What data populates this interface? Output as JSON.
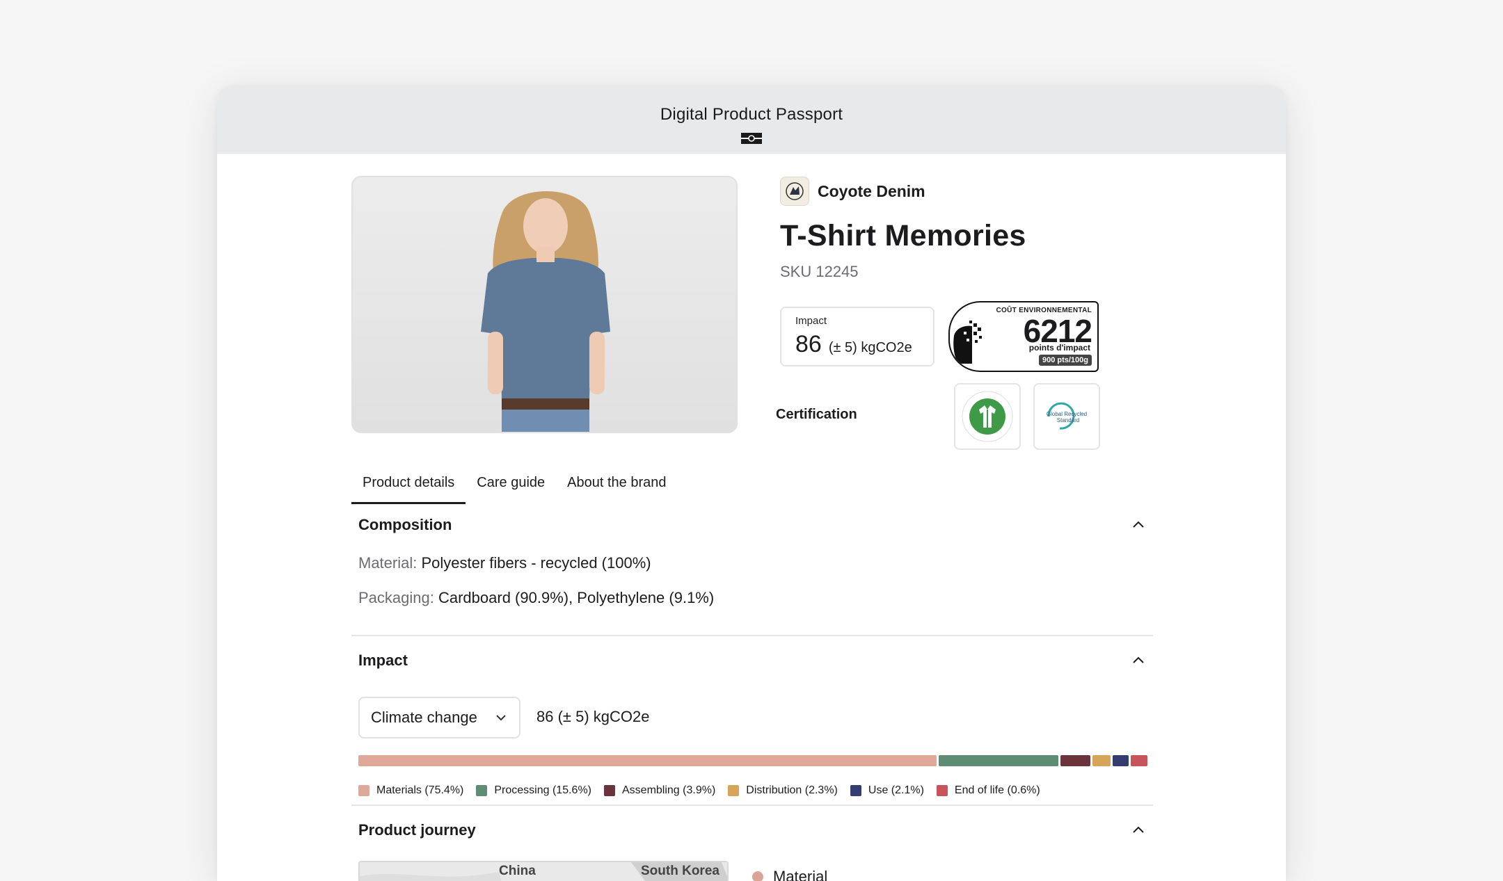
{
  "window": {
    "title": "Digital Product Passport"
  },
  "brand": {
    "name": "Coyote Denim"
  },
  "product": {
    "title": "T-Shirt Memories",
    "sku": "SKU 12245"
  },
  "impact_card": {
    "label": "Impact",
    "value": "86",
    "unit": "(± 5) kgCO2e"
  },
  "eco_label": {
    "heading": "COÛT ENVIRONNEMENTAL",
    "value": "6212",
    "points": "points d'impact",
    "badge": "900 pts/100g"
  },
  "certification": {
    "label": "Certification",
    "badges": [
      {
        "name": "gots-badge",
        "text": "GLOBAL ORGANIC TEXTILE STANDARD GOTS"
      },
      {
        "name": "grs-badge",
        "text": "Global Recycled Standard"
      }
    ]
  },
  "tabs": [
    {
      "label": "Product details",
      "active": true
    },
    {
      "label": "Care guide",
      "active": false
    },
    {
      "label": "About the brand",
      "active": false
    }
  ],
  "composition": {
    "title": "Composition",
    "material_key": "Material:",
    "material_value": "Polyester fibers - recycled (100%)",
    "packaging_key": "Packaging:",
    "packaging_value": "Cardboard (90.9%), Polyethylene (9.1%)"
  },
  "impact": {
    "title": "Impact",
    "select_value": "Climate change",
    "total": "86 (± 5) kgCO2e",
    "breakdown": [
      {
        "label": "Materials (75.4%)",
        "percent": 75.4,
        "color": "#e0a898"
      },
      {
        "label": "Processing (15.6%)",
        "percent": 15.6,
        "color": "#5e8c74"
      },
      {
        "label": "Assembling (3.9%)",
        "percent": 3.9,
        "color": "#6b343c"
      },
      {
        "label": "Distribution (2.3%)",
        "percent": 2.3,
        "color": "#d7a55a"
      },
      {
        "label": "Use (2.1%)",
        "percent": 2.1,
        "color": "#353c72"
      },
      {
        "label": "End of life (0.6%)",
        "percent": 0.6,
        "color": "#c8535a"
      }
    ]
  },
  "journey": {
    "title": "Product journey",
    "map_labels": [
      "China",
      "South Korea"
    ],
    "legend": "Material"
  }
}
